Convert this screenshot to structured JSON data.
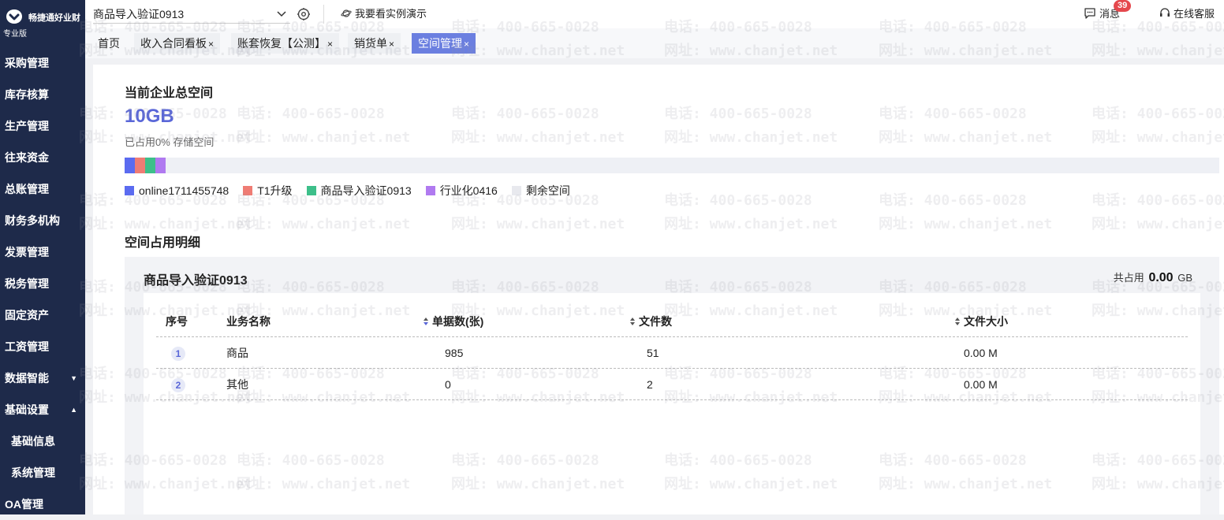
{
  "app": {
    "brand": "畅捷通好业财",
    "edition": "专业版"
  },
  "sidebar": {
    "items": [
      {
        "label": "采购管理",
        "name": "sidebar-item-purchase"
      },
      {
        "label": "库存核算",
        "name": "sidebar-item-inventory"
      },
      {
        "label": "生产管理",
        "name": "sidebar-item-production"
      },
      {
        "label": "往来资金",
        "name": "sidebar-item-funds"
      },
      {
        "label": "总账管理",
        "name": "sidebar-item-ledger"
      },
      {
        "label": "财务多机构",
        "name": "sidebar-item-multi-org"
      },
      {
        "label": "发票管理",
        "name": "sidebar-item-invoice"
      },
      {
        "label": "税务管理",
        "name": "sidebar-item-tax"
      },
      {
        "label": "固定资产",
        "name": "sidebar-item-fixed-assets"
      },
      {
        "label": "工资管理",
        "name": "sidebar-item-payroll"
      },
      {
        "label": "数据智能",
        "name": "sidebar-item-data-intel",
        "caret": "▼"
      },
      {
        "label": "基础设置",
        "name": "sidebar-item-basic-settings",
        "caret": "▲"
      },
      {
        "label": "基础信息",
        "name": "sidebar-item-basic-info",
        "sub": true
      },
      {
        "label": "系统管理",
        "name": "sidebar-item-system",
        "sub": true
      },
      {
        "label": "OA管理",
        "name": "sidebar-item-oa"
      }
    ]
  },
  "topbar": {
    "account": "商品导入验证0913",
    "demo_link": "我要看实例演示",
    "messages": "消息",
    "message_count": "39",
    "support": "在线客服"
  },
  "tabs": [
    {
      "label": "首页",
      "closable": false,
      "active": false
    },
    {
      "label": "收入合同看板",
      "closable": true,
      "active": false
    },
    {
      "label": "账套恢复【公测】",
      "closable": true,
      "active": false
    },
    {
      "label": "销货单",
      "closable": true,
      "active": false
    },
    {
      "label": "空间管理",
      "closable": true,
      "active": true
    }
  ],
  "tab_close_glyph": "×",
  "main": {
    "total_title": "当前企业总空间",
    "total_value": "10GB",
    "used_text": "已占用0% 存储空间",
    "usage_segments": [
      {
        "name": "online1711455748",
        "color": "#5b6bf0",
        "fraction": 0.0095
      },
      {
        "name": "T1升级",
        "color": "#ef7c74",
        "fraction": 0.0095
      },
      {
        "name": "商品导入验证0913",
        "color": "#3dbf8a",
        "fraction": 0.0095
      },
      {
        "name": "行业化0416",
        "color": "#b07af0",
        "fraction": 0.0095
      }
    ],
    "legend": [
      {
        "label": "online1711455748",
        "color": "#5b6bf0"
      },
      {
        "label": "T1升级",
        "color": "#ef7c74"
      },
      {
        "label": "商品导入验证0913",
        "color": "#3dbf8a"
      },
      {
        "label": "行业化0416",
        "color": "#b07af0"
      },
      {
        "label": "剩余空间",
        "color": "#e8e9ee"
      }
    ],
    "detail_title": "空间占用明细",
    "detail": {
      "account": "商品导入验证0913",
      "total_prefix": "共占用",
      "total_value": "0.00",
      "total_unit": "GB",
      "columns": [
        "序号",
        "业务名称",
        "单据数(张)",
        "文件数",
        "文件大小"
      ],
      "rows": [
        {
          "index": "1",
          "name": "商品",
          "docs": "985",
          "files": "51",
          "size": "0.00 M"
        },
        {
          "index": "2",
          "name": "其他",
          "docs": "0",
          "files": "2",
          "size": "0.00 M"
        }
      ]
    }
  },
  "watermark": {
    "phone": "电话: 400-665-0028",
    "site": "网址: www.chanjet.net"
  }
}
